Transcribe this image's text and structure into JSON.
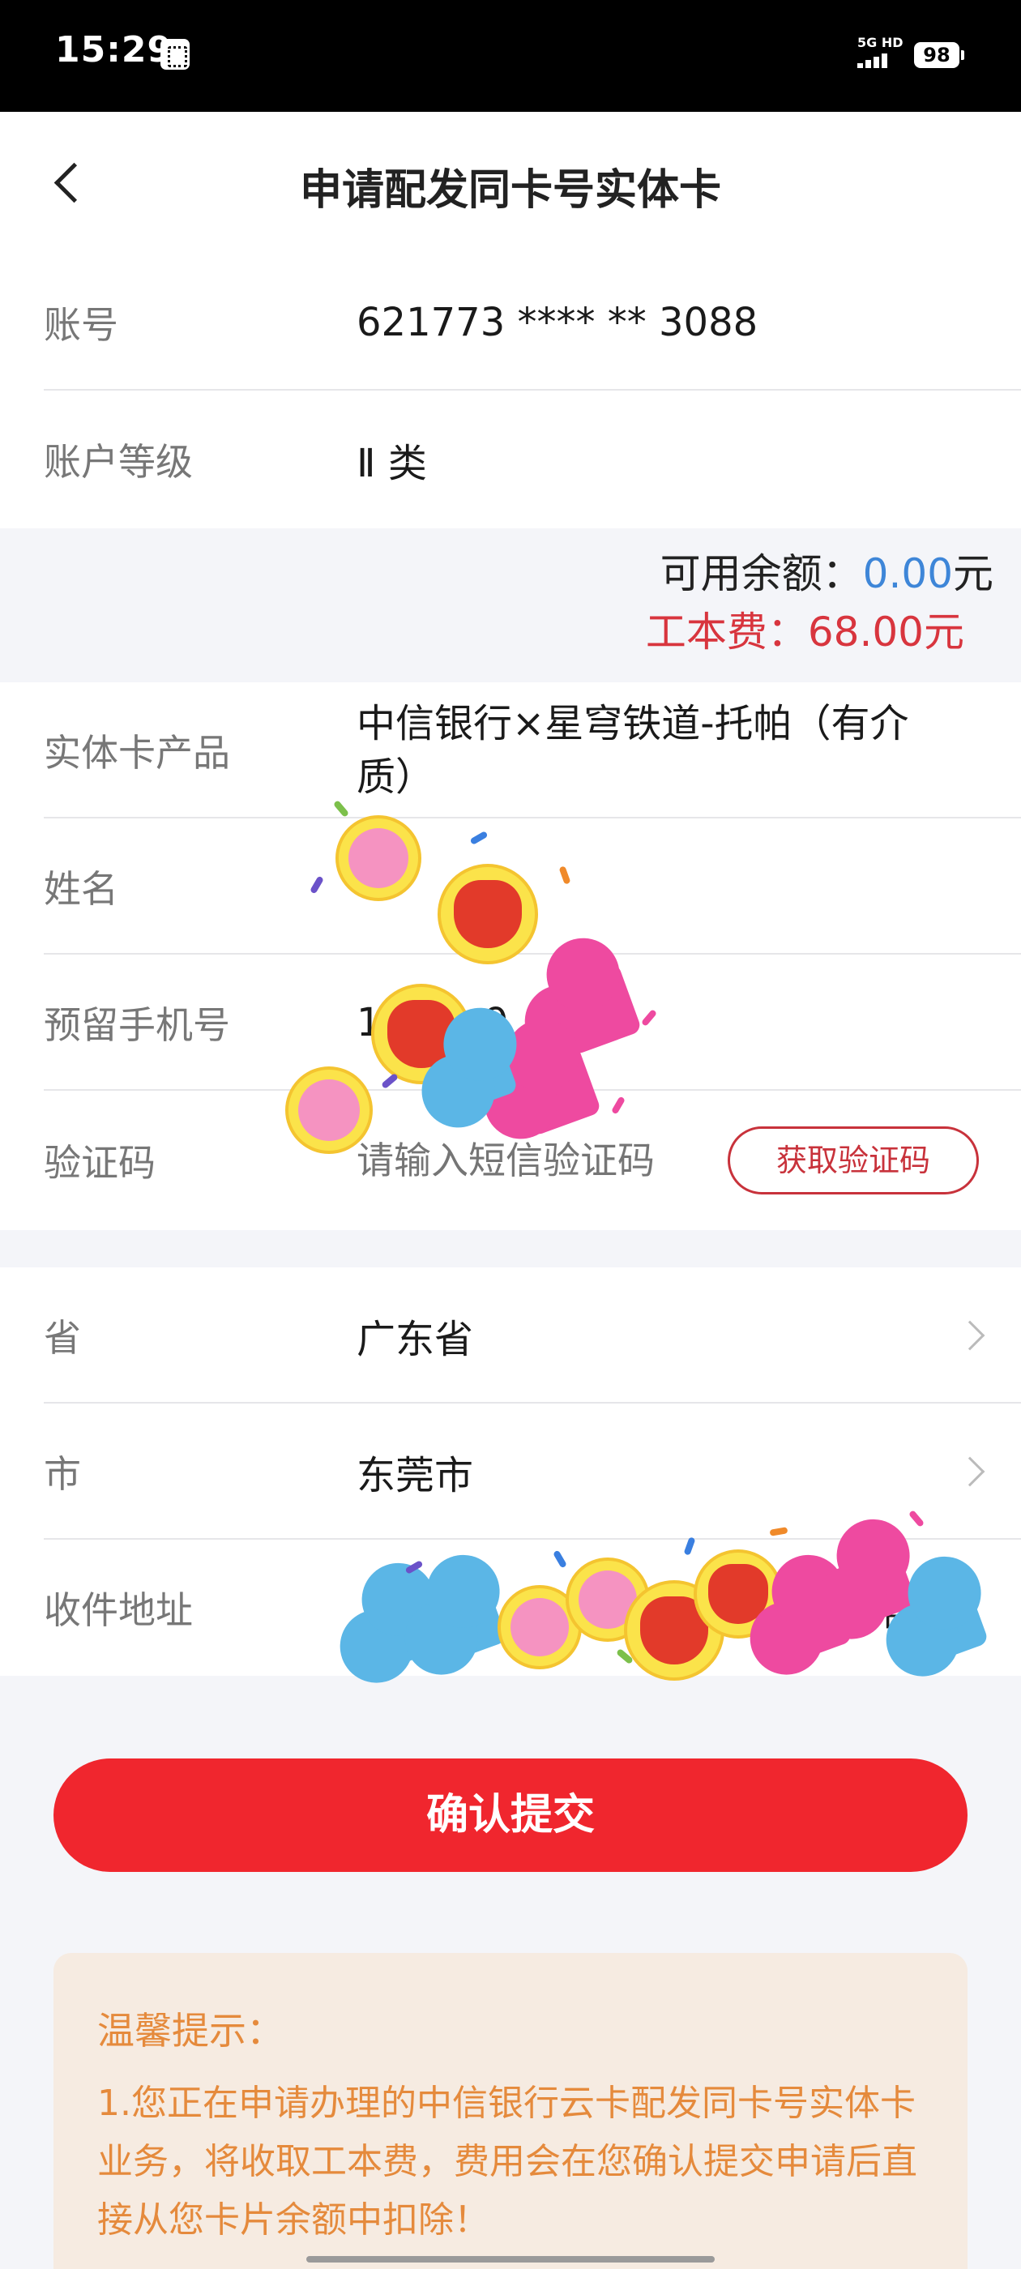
{
  "status_bar": {
    "time": "15:29",
    "network": "5G HD",
    "battery": "98"
  },
  "header": {
    "title": "申请配发同卡号实体卡",
    "back_icon": "back-arrow-icon"
  },
  "account_section": {
    "account_label": "账号",
    "account_value": "621773 **** ** 3088",
    "level_label": "账户等级",
    "level_value": "Ⅱ 类"
  },
  "balance": {
    "available_prefix": "可用余额：",
    "available_amount": "0.00",
    "available_suffix": "元",
    "fee_text": "工本费：68.00元"
  },
  "card_section": {
    "product_label": "实体卡产品",
    "product_value": "中信银行×星穹铁道-托帕（有介质）",
    "name_label": "姓名",
    "name_value": "",
    "phone_label": "预留手机号",
    "phone_value": "1**  ** 9",
    "code_label": "验证码",
    "code_placeholder": "请输入短信验证码",
    "get_code_button": "获取验证码"
  },
  "address_section": {
    "province_label": "省",
    "province_value": "广东省",
    "city_label": "市",
    "city_value": "东莞市",
    "address_label": "收件地址",
    "address_value": "公寓"
  },
  "confirm_button": "确认提交",
  "tip": {
    "title": "温馨提示：",
    "body": "1.您正在申请办理的中信银行云卡配发同卡号实体卡业务，将收取工本费，费用会在您确认提交申请后直接从您卡片余额中扣除！"
  },
  "colors": {
    "accent_red": "#f0262e",
    "amount_blue": "#3e86d8",
    "tip_orange": "#e58a3c",
    "tip_bg": "#f6ebe1"
  }
}
